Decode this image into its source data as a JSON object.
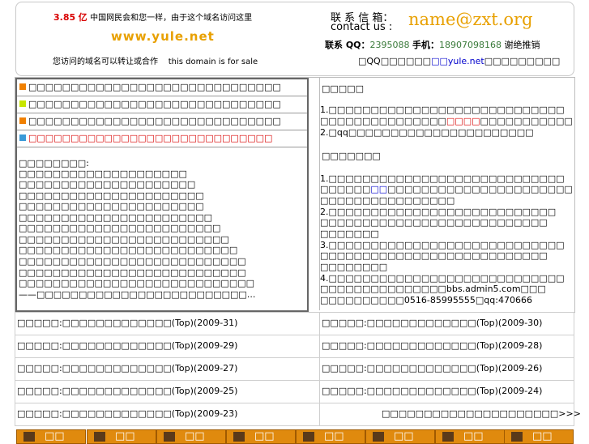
{
  "banner": {
    "price_number": "3.85",
    "price_unit": "亿",
    "slogan": "中国网民会和您一样，由于这个域名访问这里",
    "domain_name": "www.yule.net",
    "sale_cn": "您访问的域名可以转让或合作",
    "sale_en": "this domain is for sale",
    "contact_cn": "联 系 信 箱：",
    "contact_en": "contact us :",
    "email": "name@zxt.org",
    "qq_label": "联系 QQ：",
    "qq_value": "2395088",
    "phone_label": "手机：",
    "phone_value": "18907098168",
    "decline": "谢绝推销",
    "note_prefix": "□QQ□□□□□□",
    "note_link": "□□yule.net",
    "note_suffix": "□□□□□□□□□"
  },
  "notices": [
    {
      "text": "□□□□□□□□□□□□□□□□□□□□□□□□□□□□□□",
      "color": "#f08000",
      "text_color": "#000000"
    },
    {
      "text": "□□□□□□□□□□□□□□□□□□□□□□□□□□□□□□",
      "color": "#c8e600",
      "text_color": "#000000"
    },
    {
      "text": "□□□□□□□□□□□□□□□□□□□□□□□□□□□□□□",
      "color": "#f08000",
      "text_color": "#000000"
    },
    {
      "text": "□□□□□□□□□□□□□□□□□□□□□□□□□□□□□",
      "color": "#3a9ad8",
      "text_color": "#d80000"
    }
  ],
  "left_body": [
    "□□□□□□□□:",
    "□□□□□□□□□□□□□□□□□□□□",
    "□□□□□□□□□□□□□□□□□□□□□",
    "□□□□□□□□□□□□□□□□□□□□□□",
    "□□□□□□□□□□□□□□□□□□□□□□",
    "□□□□□□□□□□□□□□□□□□□□□□□",
    "□□□□□□□□□□□□□□□□□□□□□□□□",
    "□□□□□□□□□□□□□□□□□□□□□□□□□",
    "□□□□□□□□□□□□□□□□□□□□□□□□□□",
    "□□□□□□□□□□□□□□□□□□□□□□□□□□□",
    "□□□□□□□□□□□□□□□□□□□□□□□□□□□",
    "□□□□□□□□□□□□□□□□□□□□□□□□□□□□",
    "——□□□□□□□□□□□□□□□□□□□□□□□□□..."
  ],
  "right_panel": {
    "section1_title": "□□□□□",
    "s1_l1": "1.□□□□□□□□□□□□□□□□□□□□□□□□□□□□",
    "s1_l2a": "  □□□□□□□□□□□□□□□",
    "s1_l2_red": "□□□□",
    "s1_l2b": "□□□□□□□□□□□",
    "s1_l3": "2.□qq□□□□□□□□□□□□□□□□□□□□□□",
    "section2_title": "□□□□□□□",
    "s2_l1": "1.□□□□□□□□□□□□□□□□□□□□□□□□□□□□",
    "s2_l2a": "  □□□□□□",
    "s2_l2_blue": "□□",
    "s2_l2b": "□□□□□□□□□□□□□□□□□□□□□□",
    "s2_l3": "  □□□□□□□□□□□□□□□□",
    "s2_l4": "2.□□□□□□□□□□□□□□□□□□□□□□□□□□□",
    "s2_l5": "  □□□□□□□□□□□□□□□□□□□□□□□□□□□",
    "s2_l6": "  □□□□□□□",
    "s2_l7": "3.□□□□□□□□□□□□□□□□□□□□□□□□□□□□",
    "s2_l8": "  □□□□□□□□□□□□□□□□□□□□□□□□□□□",
    "s2_l9": "  □□□□□□□□",
    "s2_l10": "4.□□□□□□□□□□□□□□□□□□□□□□□□□□□□",
    "s2_l11": "  □□□□□□□□□□□□□□□bbs.admin5.com□□□",
    "s2_l12": "  □□□□□□□□□□0516-85995555□qq:470666"
  },
  "articles_left": [
    "□□□□□:□□□□□□□□□□□□□(Top)(2009-31)",
    "□□□□□:□□□□□□□□□□□□□(Top)(2009-29)",
    "□□□□□:□□□□□□□□□□□□□(Top)(2009-27)",
    "□□□□□:□□□□□□□□□□□□□(Top)(2009-25)",
    "□□□□□:□□□□□□□□□□□□□(Top)(2009-23)"
  ],
  "articles_right": [
    "□□□□□:□□□□□□□□□□□□□(Top)(2009-30)",
    "□□□□□:□□□□□□□□□□□□□(Top)(2009-28)",
    "□□□□□:□□□□□□□□□□□□□(Top)(2009-26)",
    "□□□□□:□□□□□□□□□□□□□(Top)(2009-24)",
    "□□□□□□□□□□□□□□□□□□□□□>>>"
  ],
  "footer_buttons": [
    "□□",
    "□□",
    "□□",
    "□□",
    "□□",
    "□□",
    "□□",
    "□□"
  ],
  "colors": {
    "price_red": "#d80000",
    "domain_orange": "#e8a000",
    "email_orange": "#e8a000",
    "qq_green": "#3a7a3a",
    "button_orange": "#e08a0e"
  }
}
